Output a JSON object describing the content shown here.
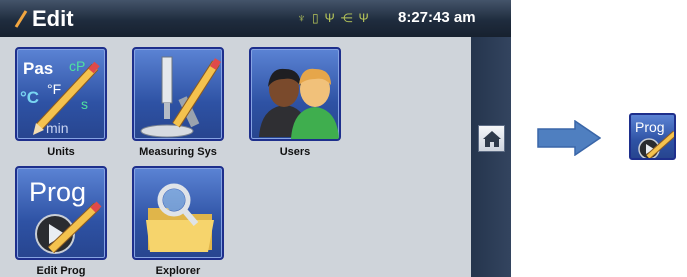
{
  "header": {
    "title": "Edit",
    "clock": "8:27:43 am",
    "status_icons": [
      "probe-icon",
      "battery-icon",
      "usb-icon",
      "network-icon",
      "usb-icon"
    ]
  },
  "tiles": [
    {
      "name": "units",
      "label": "Units",
      "icon_text": {
        "pas": "Pas",
        "cp": "cP",
        "degc": "°C",
        "degf": "°F",
        "s": "s",
        "min": "min"
      }
    },
    {
      "name": "measuring-sys",
      "label": "Measuring Sys"
    },
    {
      "name": "users",
      "label": "Users"
    },
    {
      "name": "edit-prog",
      "label": "Edit Prog",
      "icon_text": "Prog"
    },
    {
      "name": "explorer",
      "label": "Explorer"
    }
  ],
  "callout": {
    "icon_text": "Prog"
  },
  "colors": {
    "tile_blue": "#2e52a4",
    "header": "#1f2c3e",
    "arrow_blue": "#4f7fc0"
  }
}
